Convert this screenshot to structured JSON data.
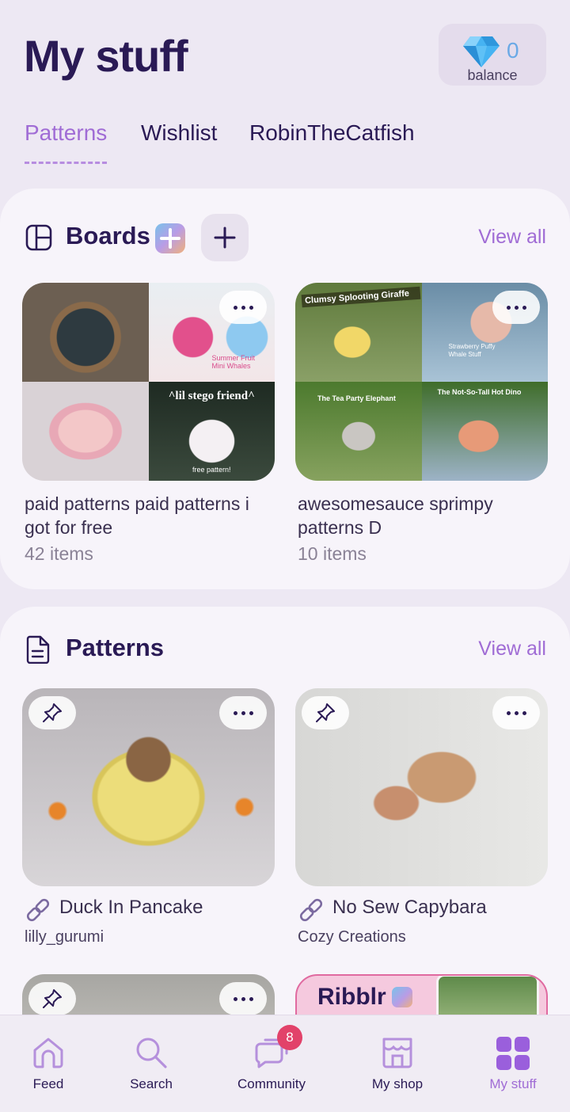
{
  "header": {
    "title": "My stuff",
    "balance": {
      "value": "0",
      "label": "balance"
    }
  },
  "tabs": [
    {
      "label": "Patterns",
      "active": true
    },
    {
      "label": "Wishlist",
      "active": false
    },
    {
      "label": "RobinTheCatfish",
      "active": false
    }
  ],
  "boards": {
    "title": "Boards",
    "view_all": "View all",
    "items": [
      {
        "name": "paid patterns paid patterns i got for free",
        "count": "42 items",
        "thumb_texts": [
          "Summer Fruit Mini Whales",
          "^lil stego friend^",
          "free pattern!"
        ]
      },
      {
        "name": "awesomesauce sprimpy patterns D",
        "count": "10 items",
        "thumb_texts": [
          "Clumsy Splooting Giraffe",
          "Strawberry Puffy Whale Stuff",
          "The Tea Party Elephant",
          "The Not-So-Tall Hot Dino"
        ]
      }
    ]
  },
  "patterns": {
    "title": "Patterns",
    "view_all": "View all",
    "items": [
      {
        "name": "Duck In Pancake",
        "author": "lilly_gurumi"
      },
      {
        "name": "No Sew Capybara",
        "author": "Cozy Creations"
      }
    ],
    "promo_logo": "Ribblr"
  },
  "nav": {
    "items": [
      {
        "label": "Feed",
        "icon": "home-icon"
      },
      {
        "label": "Search",
        "icon": "search-icon"
      },
      {
        "label": "Community",
        "icon": "chat-bubbles-icon",
        "badge": "8"
      },
      {
        "label": "My shop",
        "icon": "storefront-icon"
      },
      {
        "label": "My stuff",
        "icon": "grid-icon",
        "active": true
      }
    ]
  },
  "colors": {
    "accent": "#a06cd5",
    "title": "#2a1a55",
    "badge": "#e2426a",
    "background": "#ede8f3",
    "card": "#f7f4fa"
  }
}
